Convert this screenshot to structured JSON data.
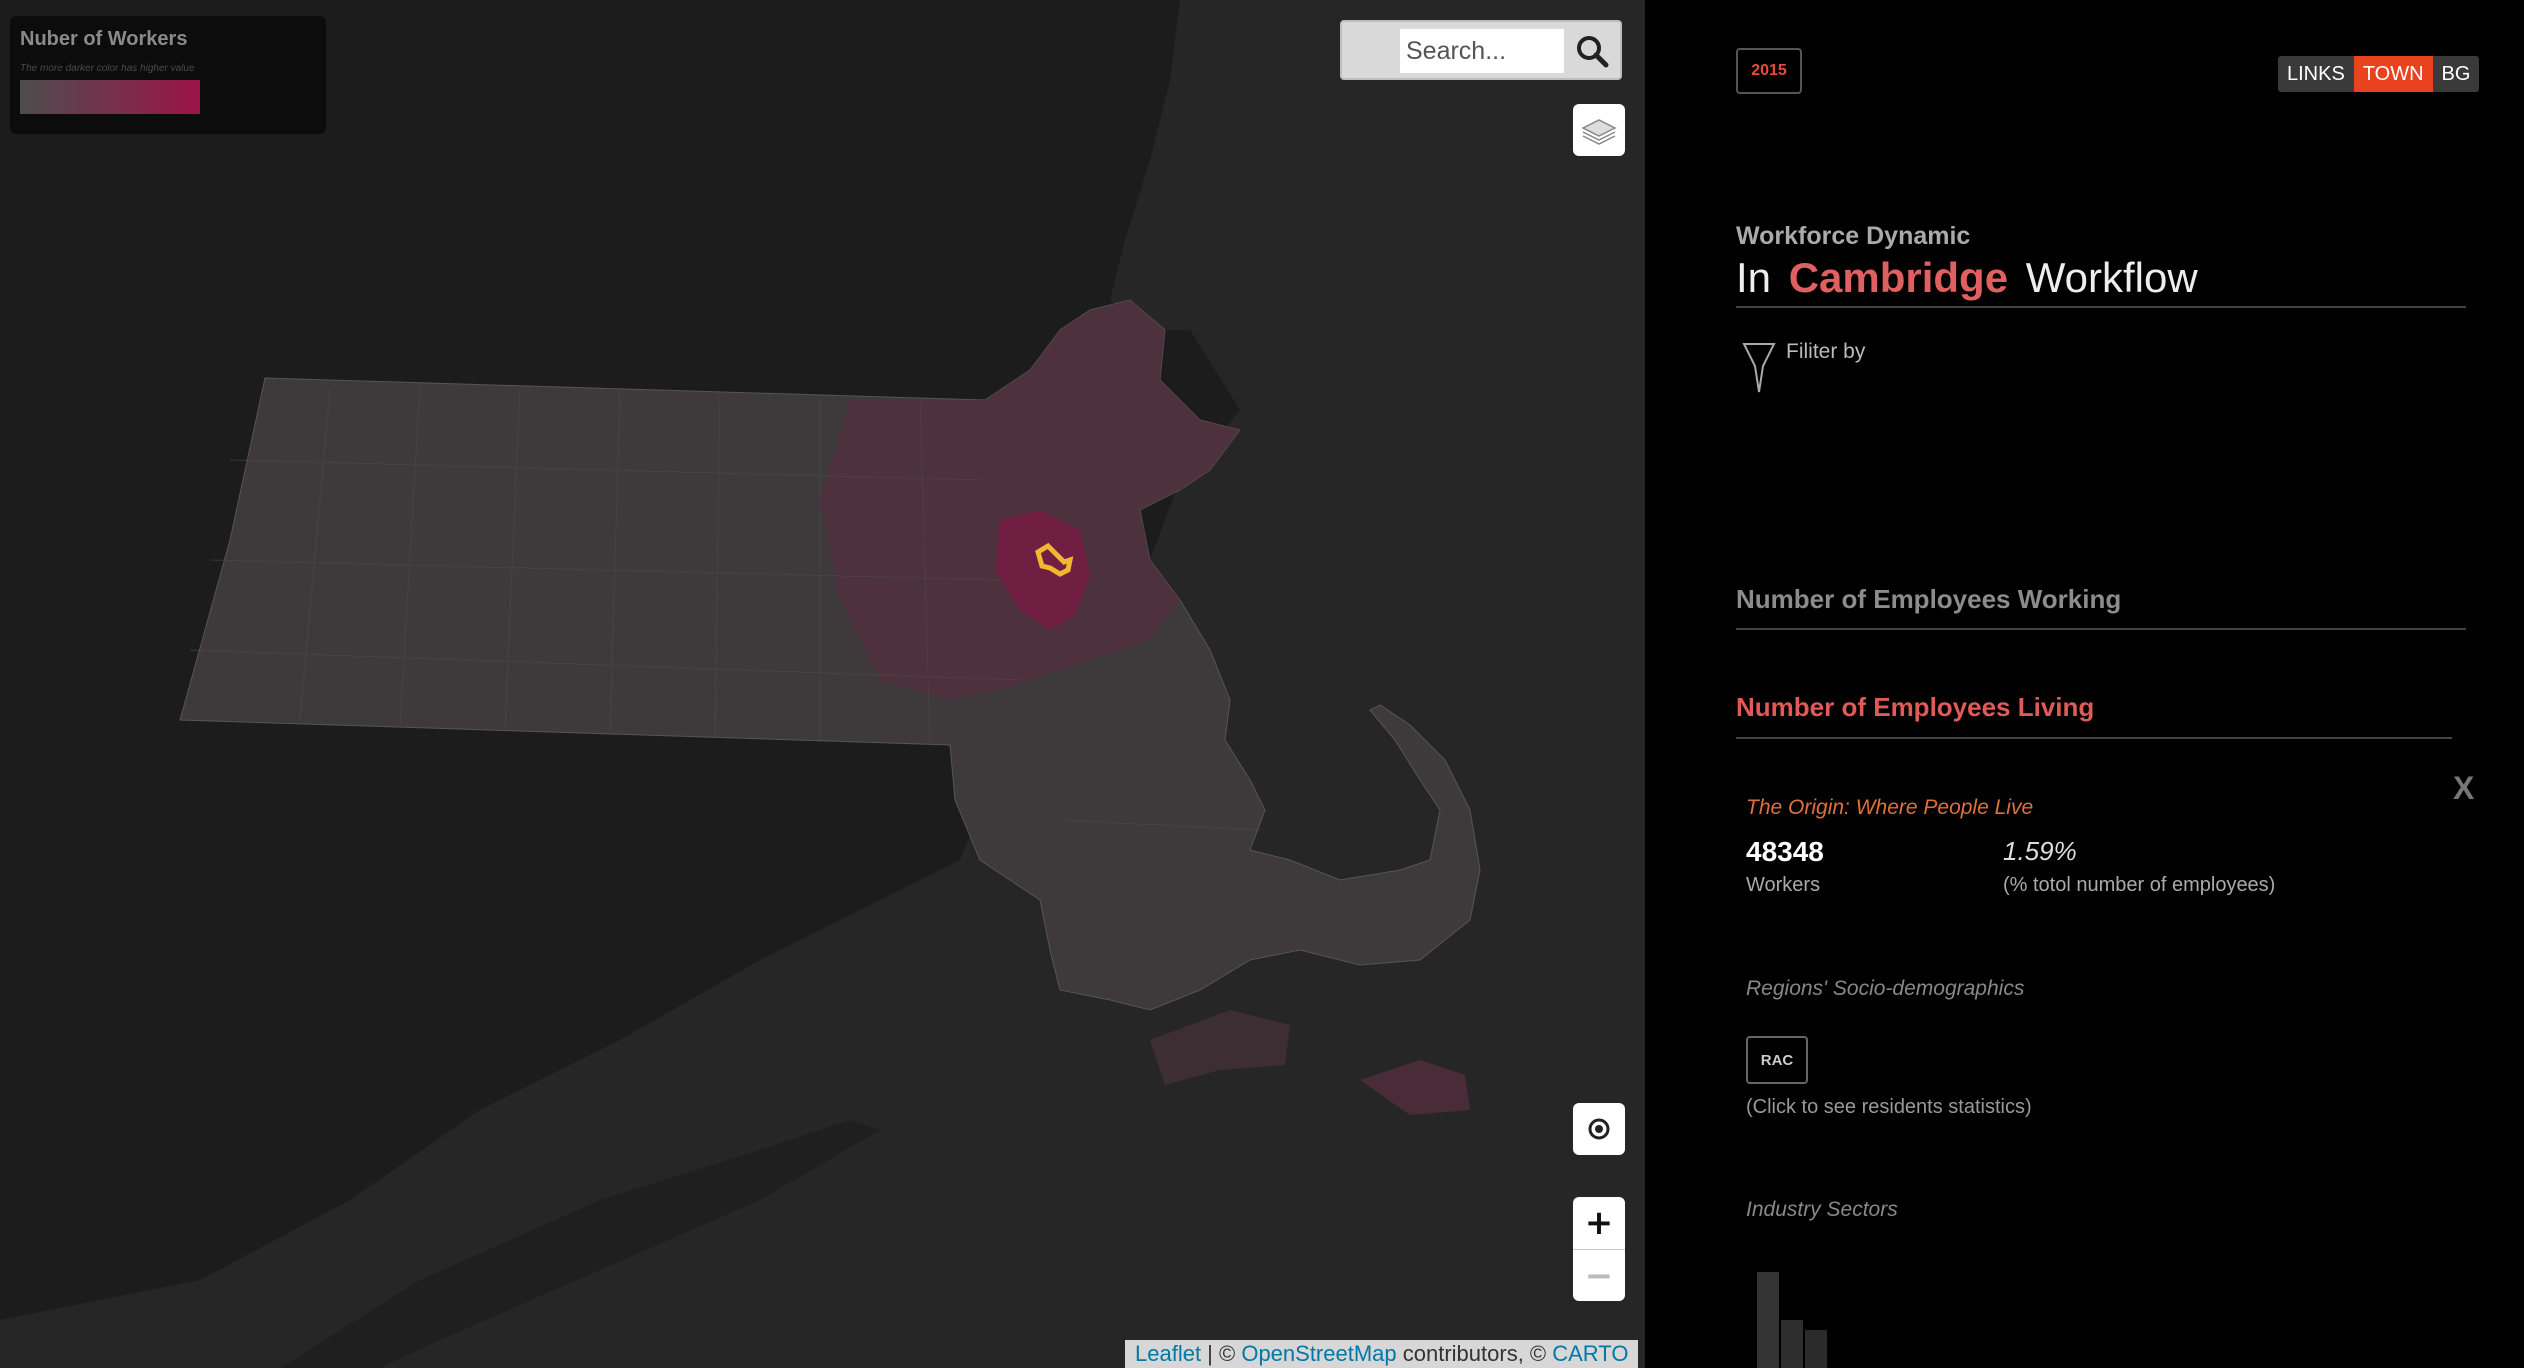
{
  "map": {
    "legend": {
      "title": "Nuber of Workers",
      "description": "The more darker color has higher value"
    },
    "search": {
      "placeholder": "Search...",
      "icon": "search-icon"
    },
    "controls": {
      "layers_icon": "layers-icon",
      "locate_icon": "locate-icon",
      "zoom_in": "+",
      "zoom_out": "−"
    },
    "attribution": {
      "leaflet": "Leaflet",
      "sep1": " | © ",
      "osm": "OpenStreetMap",
      "mid": " contributors, © ",
      "carto": "CARTO"
    },
    "colors": {
      "background": "#262626",
      "land": "#3a3a3a",
      "low": "#4d4d4d",
      "high": "#9c1447",
      "highlight": "#f0b72f"
    }
  },
  "panel": {
    "year": "2015",
    "modes": [
      {
        "label": "LINKS",
        "active": false
      },
      {
        "label": "TOWN",
        "active": true
      },
      {
        "label": "BG",
        "active": false
      }
    ],
    "workforce_label": "Workforce Dynamic",
    "title_prefix": "In",
    "city": "Cambridge",
    "title_suffix": "Workflow",
    "filter_label": "Filiter by",
    "section_working": "Number of Employees Working",
    "section_living": "Number of Employees Living",
    "origin_title": "The Origin: Where People Live",
    "close_label": "X",
    "workers_value": "48348",
    "workers_label": "Workers",
    "percent_value": "1.59%",
    "percent_label": "(% totol number of employees)",
    "socio_title": "Regions' Socio-demographics",
    "rac_label": "RAC",
    "rac_hint": "(Click to see residents statistics)",
    "industry_title": "Industry Sectors",
    "accent_colors": {
      "year": "#e84a3c",
      "toggle_active": "#e8421e",
      "city": "#e05f60",
      "origin": "#e0703a"
    }
  }
}
